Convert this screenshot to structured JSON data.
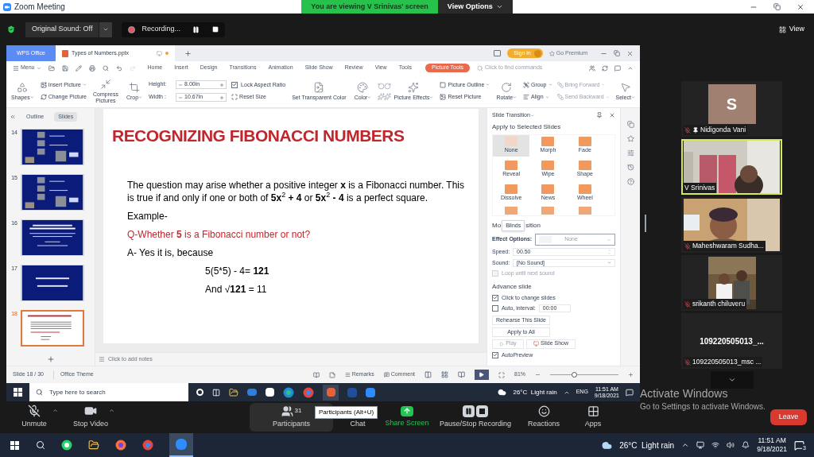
{
  "window": {
    "title": "Zoom Meeting",
    "banner": "You are viewing V Srinivas' screen",
    "view_options": "View Options"
  },
  "meeting_bar": {
    "original_sound": "Original Sound: Off",
    "recording": "Recording...",
    "view": "View"
  },
  "wps": {
    "tabs": [
      {
        "label": "WPS Office",
        "kind": "home",
        "selected": false
      },
      {
        "label": "Types of Numbers.pptx",
        "kind": "doc",
        "selected": true
      }
    ],
    "sign_in": "Sign in",
    "go_premium": "Go Premium",
    "menu": "Menu",
    "ribbon_tabs": [
      {
        "label": "Home",
        "selected": false
      },
      {
        "label": "Insert",
        "selected": false
      },
      {
        "label": "Design",
        "selected": false
      },
      {
        "label": "Transitions",
        "selected": false
      },
      {
        "label": "Animation",
        "selected": false
      },
      {
        "label": "Slide Show",
        "selected": false
      },
      {
        "label": "Review",
        "selected": false
      },
      {
        "label": "View",
        "selected": false
      },
      {
        "label": "Tools",
        "selected": false
      }
    ],
    "context_tab": {
      "label": "Picture Tools",
      "selected": true
    },
    "search": {
      "placeholder": "Click to find commands"
    },
    "ribbon": [
      {
        "kind": "large",
        "label": "Shapes",
        "dropdown": true
      },
      {
        "kind": "stack",
        "items": [
          {
            "kind": "small",
            "label": "Insert Picture",
            "dropdown": true,
            "disabled": false
          },
          {
            "kind": "small",
            "label": "Change Picture",
            "dropdown": false,
            "disabled": false
          }
        ]
      },
      {
        "kind": "large",
        "label": "Compress Pictures",
        "dropdown": false
      },
      {
        "kind": "large",
        "label": "Crop",
        "dropdown": true
      },
      {
        "kind": "stack",
        "items": [
          {
            "kind": "field",
            "label": "Height:",
            "value": "8.00in"
          },
          {
            "kind": "field",
            "label": "Width :",
            "value": "10.67in"
          }
        ]
      },
      {
        "kind": "stack",
        "items": [
          {
            "kind": "check",
            "label": "Lock Aspect Ratio",
            "checked": true
          },
          {
            "kind": "small",
            "label": "Reset Size",
            "dropdown": false,
            "disabled": false
          }
        ]
      },
      {
        "kind": "large",
        "label": "Set Transparent Color",
        "dropdown": false
      },
      {
        "kind": "large",
        "label": "Color",
        "dropdown": true
      },
      {
        "kind": "icons"
      },
      {
        "kind": "large",
        "label": "Picture Effects",
        "dropdown": true
      },
      {
        "kind": "stack",
        "items": [
          {
            "kind": "small",
            "label": "Picture Outline",
            "dropdown": true,
            "disabled": false
          },
          {
            "kind": "small",
            "label": "Reset Picture",
            "dropdown": false,
            "disabled": false
          }
        ]
      },
      {
        "kind": "large",
        "label": "Rotate",
        "dropdown": true
      },
      {
        "kind": "stack",
        "items": [
          {
            "kind": "small",
            "label": "Group",
            "dropdown": true,
            "disabled": false
          },
          {
            "kind": "small",
            "label": "Align",
            "dropdown": true,
            "disabled": false
          }
        ]
      },
      {
        "kind": "stack",
        "items": [
          {
            "kind": "small",
            "label": "Bring Forward",
            "dropdown": true,
            "disabled": true
          },
          {
            "kind": "small",
            "label": "Send Backward",
            "dropdown": true,
            "disabled": true
          }
        ]
      },
      {
        "kind": "large",
        "label": "Select",
        "dropdown": true
      }
    ],
    "slides_pane": {
      "tabs": [
        {
          "label": "Outline",
          "selected": false
        },
        {
          "label": "Slides",
          "selected": true
        }
      ],
      "thumbnails": [
        {
          "number": "14",
          "kind": "photos",
          "selected": false
        },
        {
          "number": "15",
          "kind": "photos",
          "selected": false
        },
        {
          "number": "16",
          "kind": "text",
          "selected": false
        },
        {
          "number": "17",
          "kind": "title",
          "selected": false
        },
        {
          "number": "18",
          "kind": "light",
          "selected": true
        }
      ]
    },
    "slide": {
      "title": "RECOGNIZING FIBONACCI NUMBERS",
      "paragraphs": [
        {
          "kind": "body",
          "text": "The question may arise whether a positive integer **x** is a Fibonacci number. This is true if and only if one or both of **5x**$^{2}$ **+ 4**  or **5x**$^{2}$ **- 4** is a perfect square."
        },
        {
          "kind": "body",
          "text": "Example-"
        },
        {
          "kind": "question",
          "text": "Q-Whether **5** is a Fibonacci number or not?"
        },
        {
          "kind": "body",
          "text": "A- Yes it is, because"
        },
        {
          "kind": "formula",
          "text": "5(5*5) - 4= **121**"
        },
        {
          "kind": "formula",
          "text": "And √**121** = 11"
        }
      ]
    },
    "notes": {
      "placeholder": "Click to add notes"
    },
    "transition": {
      "title": "Slide Transition",
      "subtitle": "Apply to Selected Slides",
      "effects": [
        {
          "label": "None",
          "selected": true
        },
        {
          "label": "Morph",
          "selected": false
        },
        {
          "label": "Fade",
          "selected": false
        },
        {
          "label": "Reveal",
          "selected": false
        },
        {
          "label": "Wipe",
          "selected": false
        },
        {
          "label": "Shape",
          "selected": false
        },
        {
          "label": "Dissolve",
          "selected": false
        },
        {
          "label": "News",
          "selected": false
        },
        {
          "label": "Wheel",
          "selected": false
        }
      ],
      "heading_start": "Mo",
      "tooltip": "Blinds",
      "heading_end": "sition",
      "effect_options": {
        "label": "Effect Options:",
        "value": "None"
      },
      "speed": {
        "label": "Speed:",
        "value": "00.50"
      },
      "sound": {
        "label": "Sound:",
        "value": "[No Sound]"
      },
      "loop": {
        "label": "Loop until next sound",
        "checked": false,
        "disabled": true
      },
      "advance_heading": "Advance slide",
      "click_change": {
        "label": "Click to change slides",
        "checked": true
      },
      "auto": {
        "label": "Auto, interval:",
        "checked": false,
        "value": "00:00"
      },
      "rehearse": "Rehearse This Slide",
      "apply_all": "Apply to All",
      "play": {
        "label": "Play",
        "disabled": true
      },
      "slide_show": "Slide Show",
      "autopreview": {
        "label": "AutoPreview",
        "checked": true
      }
    },
    "status_bar": {
      "slide": "Slide 18 / 30",
      "theme": "Office Theme",
      "remarks": "Remarks",
      "comment": "Comment",
      "zoom": "81%",
      "level": 0.35
    }
  },
  "remote_taskbar": {
    "search": {
      "placeholder": "Type here to search"
    },
    "weather": "26°C  Light rain",
    "language": "ENG",
    "time": "11:51 AM",
    "date": "9/18/2021"
  },
  "participants": [
    {
      "name": "Nidigonda Vani",
      "kind": "avatar",
      "initial": "S",
      "muted": true,
      "pinned": true,
      "active": false
    },
    {
      "name": "V Srinivas",
      "kind": "room",
      "muted": false,
      "pinned": false,
      "active": true
    },
    {
      "name": "Maheshwaram Sudha...",
      "kind": "person",
      "muted": true,
      "pinned": false,
      "active": false
    },
    {
      "name": "srikanth chiluveru",
      "kind": "pair",
      "muted": true,
      "pinned": false,
      "active": false
    },
    {
      "name": "109220505013_msc ...",
      "kind": "name",
      "display": "109220505013_...",
      "muted": true,
      "pinned": false,
      "active": false
    }
  ],
  "toolbar": {
    "items": [
      {
        "kind": "mic",
        "label": "Unmute",
        "menu": true
      },
      {
        "kind": "video",
        "label": "Stop Video",
        "menu": true
      },
      {
        "kind": "participants",
        "label": "Participants",
        "count": "31",
        "menu": false
      },
      {
        "kind": "chat",
        "label": "Chat",
        "menu": false
      },
      {
        "kind": "share",
        "label": "Share Screen",
        "menu": false
      },
      {
        "kind": "recording",
        "label": "Pause/Stop Recording",
        "menu": false
      },
      {
        "kind": "reactions",
        "label": "Reactions",
        "menu": false
      },
      {
        "kind": "apps",
        "label": "Apps",
        "menu": false
      }
    ],
    "tooltip": "Participants (Alt+U)",
    "leave": "Leave"
  },
  "activate_windows": {
    "title": "Activate Windows",
    "text": "Go to Settings to activate Windows."
  },
  "taskbar": {
    "weather": "26°C  Light rain",
    "time": "11:51 AM",
    "date": "9/18/2021",
    "notifications": "3"
  }
}
